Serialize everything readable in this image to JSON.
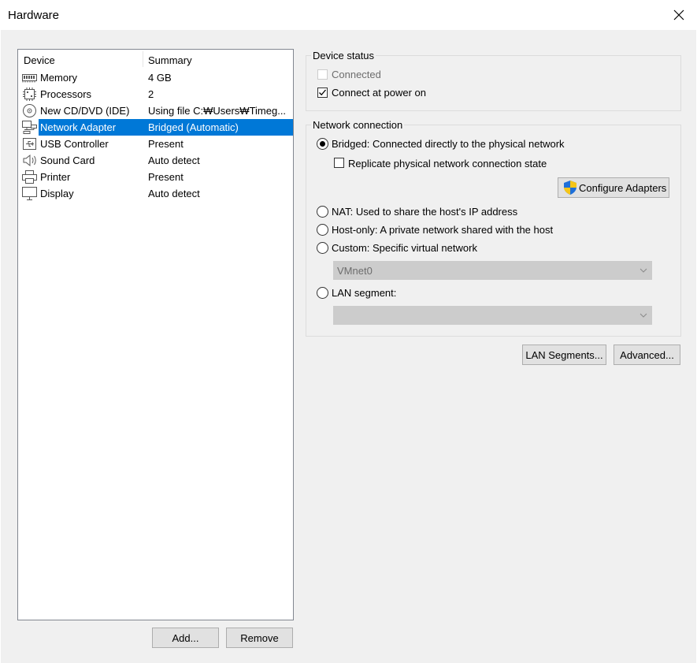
{
  "window": {
    "title": "Hardware",
    "close_icon": "close-icon"
  },
  "device_list": {
    "columns": [
      "Device",
      "Summary"
    ],
    "rows": [
      {
        "icon": "memory-icon",
        "name": "Memory",
        "summary": "4 GB"
      },
      {
        "icon": "processor-icon",
        "name": "Processors",
        "summary": "2"
      },
      {
        "icon": "cd-dvd-icon",
        "name": "New CD/DVD (IDE)",
        "summary": "Using file C:₩Users₩Timeg..."
      },
      {
        "icon": "network-adapter-icon",
        "name": "Network Adapter",
        "summary": "Bridged (Automatic)"
      },
      {
        "icon": "usb-icon",
        "name": "USB Controller",
        "summary": "Present"
      },
      {
        "icon": "sound-icon",
        "name": "Sound Card",
        "summary": "Auto detect"
      },
      {
        "icon": "printer-icon",
        "name": "Printer",
        "summary": "Present"
      },
      {
        "icon": "display-icon",
        "name": "Display",
        "summary": "Auto detect"
      }
    ],
    "selected_row": "Network Adapter",
    "add_label": "Add...",
    "remove_label": "Remove"
  },
  "device_status": {
    "label": "Device status",
    "connected": {
      "label": "Connected",
      "checked": false,
      "enabled": false
    },
    "connect_at_power_on": {
      "label": "Connect at power on",
      "checked": true
    }
  },
  "network_connection": {
    "label": "Network connection",
    "bridged": {
      "label": "Bridged: Connected directly to the physical network",
      "selected": true
    },
    "replicate": {
      "label": "Replicate physical network connection state",
      "checked": false
    },
    "configure_adapters_label": "Configure Adapters",
    "nat": {
      "label": "NAT: Used to share the host's IP address",
      "selected": false
    },
    "host_only": {
      "label": "Host-only: A private network shared with the host",
      "selected": false
    },
    "custom": {
      "label": "Custom: Specific virtual network",
      "selected": false
    },
    "custom_network_value": "VMnet0",
    "lan_segment": {
      "label": "LAN segment:",
      "selected": false
    },
    "lan_segment_value": ""
  },
  "footer": {
    "lan_segments_label": "LAN Segments...",
    "advanced_label": "Advanced..."
  },
  "colors": {
    "selection": "#0078d7",
    "dialog_bg": "#f0f0f0",
    "shield_blue": "#1e6fd9",
    "shield_yellow": "#f5c518"
  }
}
